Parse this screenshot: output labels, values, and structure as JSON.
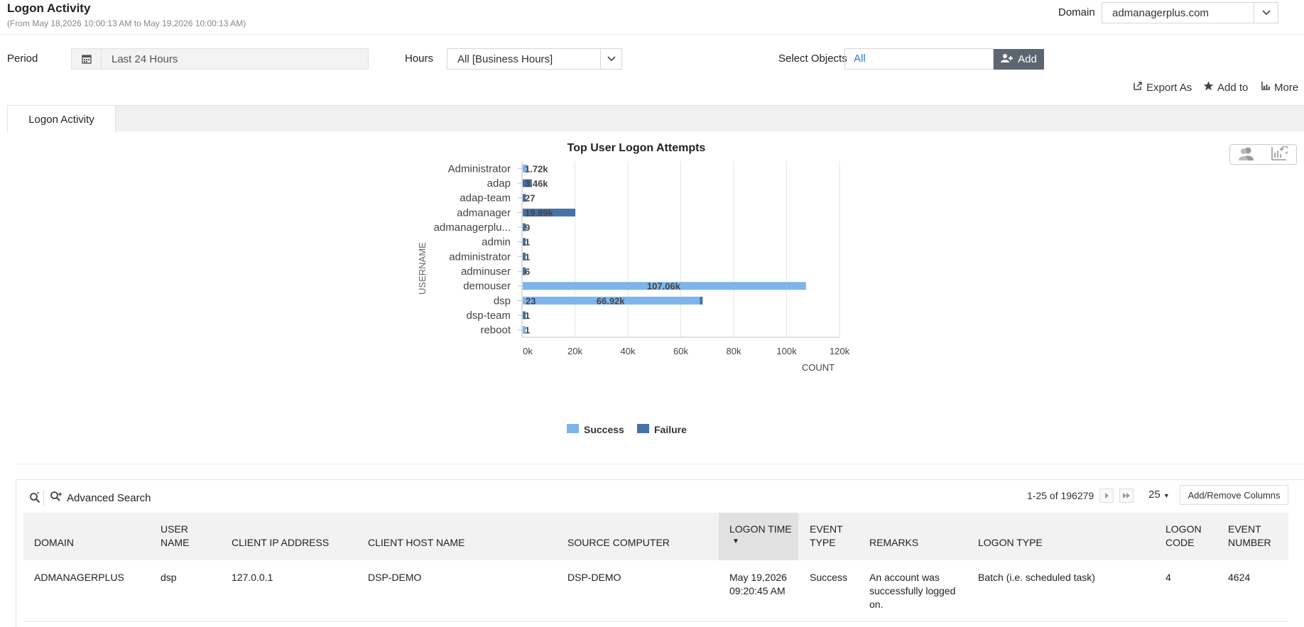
{
  "header": {
    "title": "Logon Activity",
    "subtitle": "(From May 18,2026 10:00:13 AM to May 19,2026 10:00:13 AM)",
    "domain_label": "Domain",
    "domain_value": "admanagerplus.com"
  },
  "filters": {
    "period_label": "Period",
    "period_value": "Last 24 Hours",
    "hours_label": "Hours",
    "hours_value": "All [Business Hours]",
    "objects_label": "Select Objects",
    "objects_value": "All",
    "add_label": "Add"
  },
  "actions": {
    "export": "Export As",
    "add_to": "Add to",
    "more": "More"
  },
  "tabs": [
    {
      "label": "Logon Activity"
    }
  ],
  "chart_data": {
    "type": "bar",
    "orientation": "horizontal",
    "stacked": true,
    "title": "Top User Logon Attempts",
    "xlabel": "COUNT",
    "ylabel": "USERNAME",
    "xlim": [
      0,
      120000
    ],
    "xticks": [
      "0k",
      "20k",
      "40k",
      "60k",
      "80k",
      "100k",
      "120k"
    ],
    "categories": [
      "Administrator",
      "adap",
      "adap-team",
      "admanager",
      "admanagerplu...",
      "admin",
      "administrator",
      "adminuser",
      "demouser",
      "dsp",
      "dsp-team",
      "reboot"
    ],
    "series": [
      {
        "name": "Success",
        "color": "#7cb5ec",
        "values": [
          1720,
          0,
          0,
          0,
          0,
          0,
          0,
          0,
          107060,
          66920,
          0,
          1
        ]
      },
      {
        "name": "Failure",
        "color": "#4572a7",
        "values": [
          0,
          3460,
          27,
          19890,
          9,
          1,
          1,
          6,
          0,
          23,
          1,
          0
        ]
      }
    ],
    "data_labels": [
      "1.72k",
      "3.46k",
      "27",
      "19.89k",
      "9",
      "1",
      "1",
      "6",
      "107.06k",
      "66.92k",
      "1",
      "1"
    ],
    "dsp_failure_label": "23",
    "legend": {
      "position": "bottom-center",
      "items": [
        "Success",
        "Failure"
      ]
    },
    "grid": true
  },
  "grid": {
    "advanced_search": "Advanced Search",
    "pager_text": "1-25 of 196279",
    "page_size": "25",
    "columns_button": "Add/Remove Columns",
    "columns": [
      {
        "l1": "",
        "l2": "DOMAIN"
      },
      {
        "l1": "USER",
        "l2": "NAME"
      },
      {
        "l1": "",
        "l2": "CLIENT IP ADDRESS"
      },
      {
        "l1": "",
        "l2": "CLIENT HOST NAME"
      },
      {
        "l1": "",
        "l2": "SOURCE COMPUTER"
      },
      {
        "l1": "LOGON TIME",
        "l2": ""
      },
      {
        "l1": "EVENT",
        "l2": "TYPE"
      },
      {
        "l1": "",
        "l2": "REMARKS"
      },
      {
        "l1": "",
        "l2": "LOGON TYPE"
      },
      {
        "l1": "LOGON",
        "l2": "CODE"
      },
      {
        "l1": "EVENT",
        "l2": "NUMBER"
      }
    ],
    "rows": [
      {
        "domain": "ADMANAGERPLUS",
        "user": "dsp",
        "ip": "127.0.0.1",
        "host": "DSP-DEMO",
        "source": "DSP-DEMO",
        "time1": "May 19,2026",
        "time2": "09:20:45 AM",
        "event_type": "Success",
        "remarks1": "An account was",
        "remarks2": "successfully logged",
        "remarks3": "on.",
        "logon_type": "Batch (i.e. scheduled task)",
        "code": "4",
        "number": "4624"
      }
    ]
  }
}
